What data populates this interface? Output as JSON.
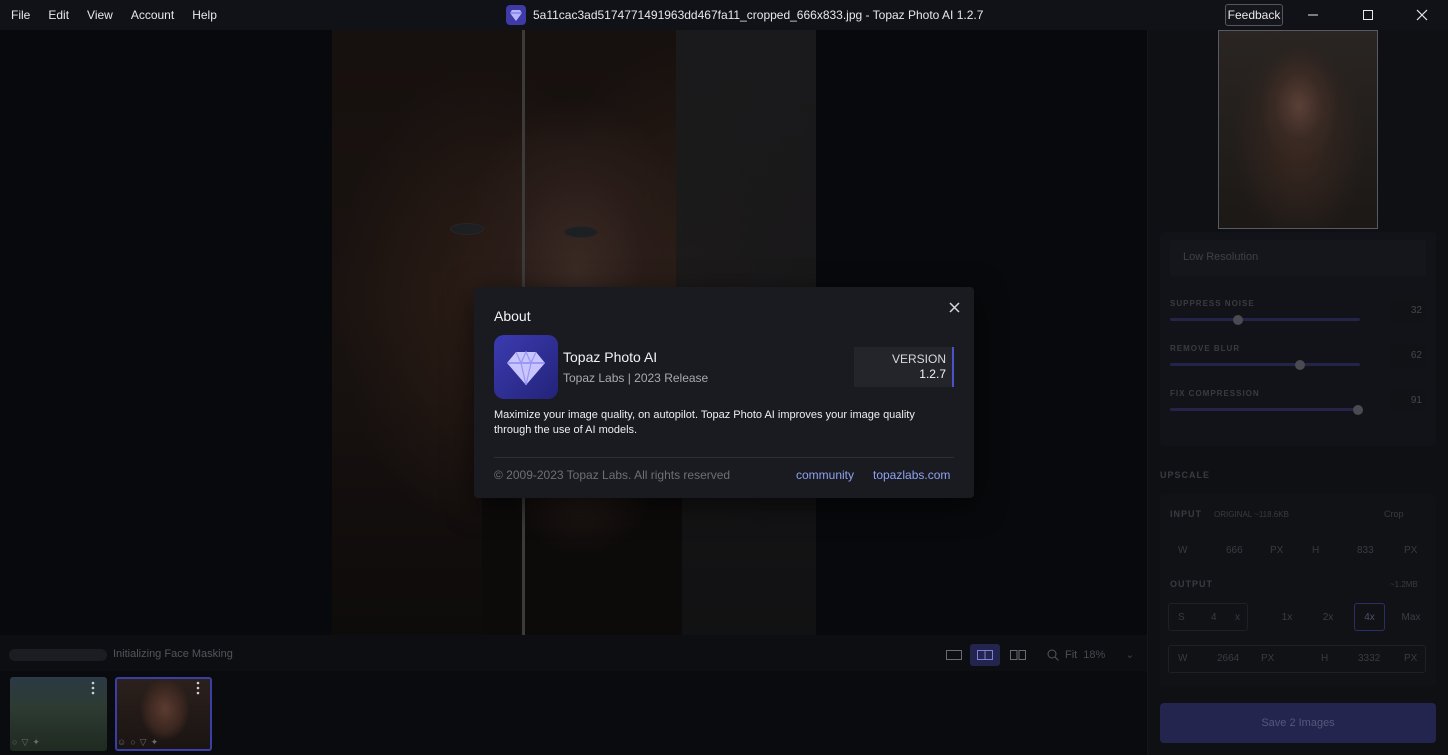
{
  "menu": {
    "items": [
      "File",
      "Edit",
      "View",
      "Account",
      "Help"
    ]
  },
  "window": {
    "title": "5a11cac3ad5174771491963dd467fa11_cropped_666x833.jpg - Topaz Photo AI 1.2.7",
    "feedback_label": "Feedback"
  },
  "panel": {
    "model_placeholder": "Low Resolution",
    "sliders": [
      {
        "label": "SUPPRESS NOISE",
        "value": "32",
        "level": 0.36
      },
      {
        "label": "REMOVE BLUR",
        "value": "62",
        "level": 0.68
      },
      {
        "label": "FIX COMPRESSION",
        "value": "91",
        "level": 0.98
      }
    ],
    "upscale_title": "UPSCALE",
    "input_label": "INPUT",
    "input_info": "ORIGINAL  ~118.6KB",
    "crop_label": "Crop",
    "input_w_label": "W",
    "input_w_value": "666",
    "input_h_label": "H",
    "input_h_value": "833",
    "px_unit": "PX",
    "output_label": "OUTPUT",
    "output_size": "~1.2MB",
    "scale_label": "S",
    "scale_value": "4",
    "scale_unit": "x",
    "scale_options": [
      "1x",
      "2x",
      "4x",
      "Max"
    ],
    "active_scale": "4x",
    "output_w_label": "W",
    "output_w_value": "2664",
    "output_h_label": "H",
    "output_h_value": "3332",
    "save_label": "Save 2 Images"
  },
  "status": {
    "progress_text": "Initializing Face Masking",
    "zoom_label": "Fit",
    "zoom_value": "18%"
  },
  "about": {
    "title": "About",
    "app_name": "Topaz Photo AI",
    "app_sub": "Topaz Labs | 2023 Release",
    "version_label": "VERSION",
    "version_number": "1.2.7",
    "description": "Maximize your image quality, on autopilot. Topaz Photo AI improves your image quality through the use of AI models.",
    "copyright": "© 2009-2023 Topaz Labs. All rights reserved",
    "link_community": "community",
    "link_site": "topazlabs.com"
  },
  "colors": {
    "accent": "#4e52c8",
    "link": "#8ea2f0",
    "modal_bg": "#1a1b20"
  }
}
